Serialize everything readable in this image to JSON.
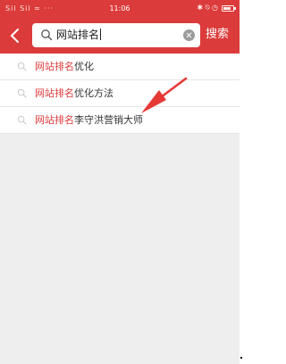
{
  "statusbar": {
    "signal": "Sil Sil ≈ ···",
    "time": "11:06",
    "icons": "✱ ⍉ ◷"
  },
  "header": {
    "back_icon": "chevron-left-icon",
    "search": {
      "value": "网站排名",
      "search_icon": "search-icon",
      "clear_icon": "clear-circle-icon"
    },
    "search_button": "搜索"
  },
  "suggestions": [
    {
      "highlight": "网站排名",
      "rest": "优化"
    },
    {
      "highlight": "网站排名",
      "rest": "优化方法"
    },
    {
      "highlight": "网站排名",
      "rest": "李守洪营销大师"
    }
  ],
  "colors": {
    "brand": "#dc3b3b",
    "annotation_arrow": "#e53935"
  }
}
